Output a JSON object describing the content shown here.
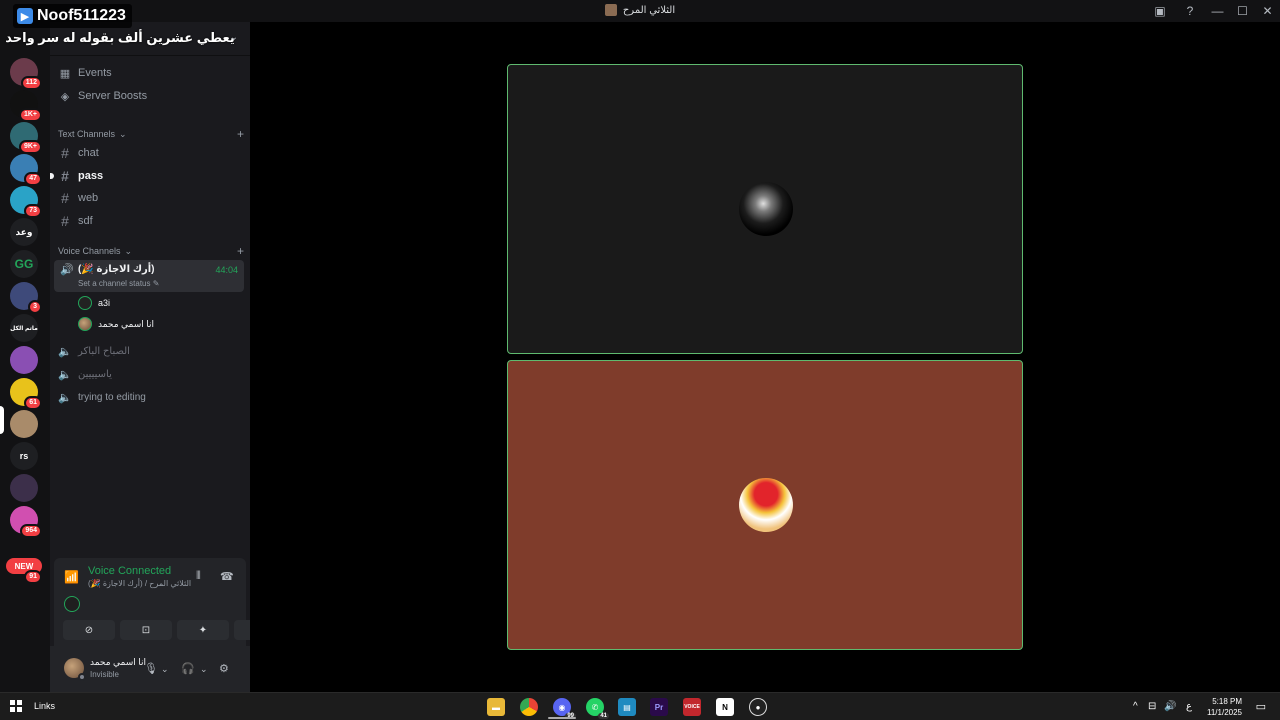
{
  "overlay_badge": {
    "name": "Noof511223"
  },
  "window": {
    "title": "الثلاثي المرح"
  },
  "titlebar_icons": [
    "inbox-icon",
    "help-icon",
    "minimize-icon",
    "maximize-icon",
    "close-icon"
  ],
  "server_rail": {
    "servers": [
      {
        "label": "",
        "badge": "112",
        "color": "#6b3b4b"
      },
      {
        "label": "",
        "badge": "1K+",
        "color": "#111111"
      },
      {
        "label": "",
        "badge": "9K+",
        "color": "#2f6a73"
      },
      {
        "label": "",
        "badge": "47",
        "color": "#3a7fb4"
      },
      {
        "label": "",
        "badge": "73",
        "color": "#2aa3c7"
      },
      {
        "label": "وعد",
        "badge": "",
        "color": "#1e1f22"
      },
      {
        "label": "GG",
        "badge": "",
        "color": "#1e1f22"
      },
      {
        "label": "",
        "badge": "3",
        "color": "#3e4a7a"
      },
      {
        "label": "ماتم الكل",
        "badge": "",
        "color": "#1e1f22"
      },
      {
        "label": "",
        "badge": "",
        "color": "#8a4fb3"
      },
      {
        "label": "",
        "badge": "61",
        "color": "#e8c21b"
      },
      {
        "label": "",
        "badge": "",
        "color": "#a98b6a"
      },
      {
        "label": "rs",
        "badge": "",
        "color": "#1e1f22"
      },
      {
        "label": "",
        "badge": "",
        "color": "#3c2f4a"
      },
      {
        "label": "",
        "badge": "964",
        "color": "#d14fb0"
      }
    ],
    "new_pill": "NEW",
    "new_badge": "91"
  },
  "server": {
    "name": "يعطي عشرين ألف بقوله له سر واحد",
    "menu": [
      {
        "label": "Events",
        "icon": "calendar-icon"
      },
      {
        "label": "Server Boosts",
        "icon": "boost-icon"
      }
    ]
  },
  "text_channels": {
    "category": "Text Channels",
    "channels": [
      {
        "name": "chat"
      },
      {
        "name": "pass"
      },
      {
        "name": "web"
      },
      {
        "name": "sdf"
      }
    ]
  },
  "voice_channels": {
    "category": "Voice Channels",
    "active": {
      "name": "(أرك الاجازة 🎉)",
      "time": "44:04",
      "status": "Set a channel status",
      "users": [
        {
          "name": "a3i"
        },
        {
          "name": "انا اسمي محمد"
        }
      ]
    },
    "others": [
      {
        "name": "الصباح الباكر"
      },
      {
        "name": "ياسيييين"
      },
      {
        "name": "trying to editing"
      }
    ]
  },
  "voice_connected": {
    "title": "Voice Connected",
    "subtitle": "الثلاثي المرح / (أرك الاجازة 🎉)"
  },
  "user": {
    "name": "انا اسمي محمد",
    "status": "Invisible"
  },
  "taskbar": {
    "links_label": "Links",
    "discord_badge": "99",
    "whatsapp_badge": "41",
    "premiere_label": "Pr",
    "notion_label": "N",
    "lang": "ع",
    "time": "5:18 PM",
    "date": "11/1/2025"
  },
  "colors": {
    "accent_green": "#23a55a",
    "tile_border": "#5fba6f",
    "tile2_bg": "#7f3c2b",
    "sidebar_bg": "#1a1a1e"
  }
}
